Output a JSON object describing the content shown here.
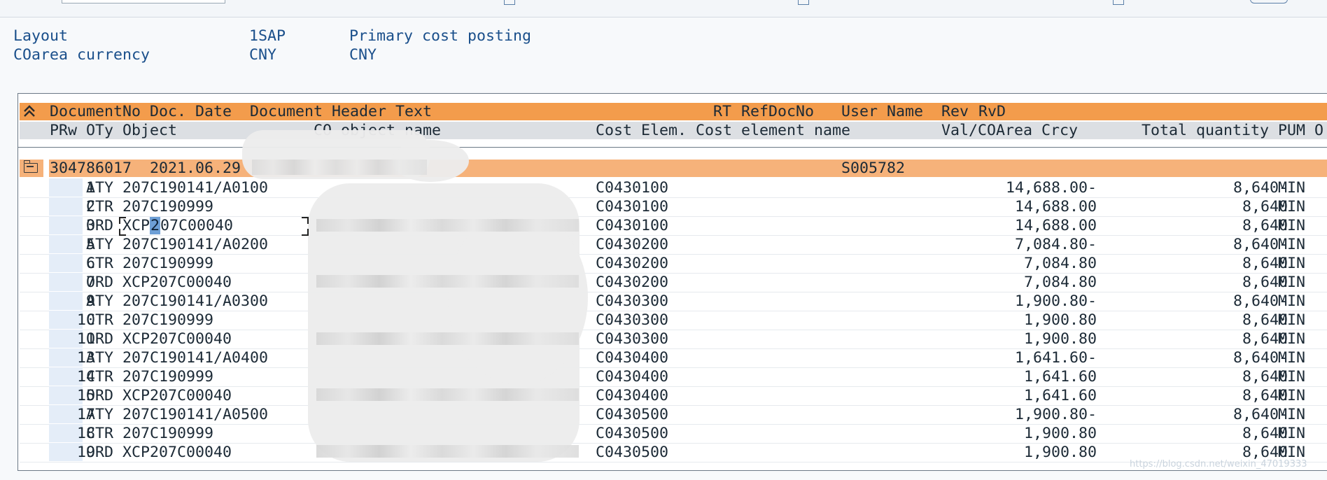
{
  "header": {
    "layout_label": "Layout",
    "layout_value": "1SAP",
    "layout_desc": "Primary cost posting",
    "currency_label": "COarea currency",
    "currency_value": "CNY",
    "currency_desc": "CNY"
  },
  "columns_line1": {
    "document_no": "DocumentNo",
    "doc_date": "Doc. Date",
    "doc_header_text": "Document Header Text",
    "rt": "RT",
    "ref_doc_no": "RefDocNo",
    "user_name": "User Name",
    "rev": "Rev",
    "rvd": "RvD"
  },
  "columns_line2": {
    "prw": "PRw",
    "oty": "OTy",
    "object": "Object",
    "co_object_name": "CO object name",
    "cost_elem": "Cost Elem.",
    "cost_elem_name": "Cost element name",
    "val_coarea": "Val/COArea Crcy",
    "total_qty": "Total quantity",
    "pum": "PUM",
    "o": "O"
  },
  "group": {
    "document_no": "304786017",
    "doc_date": "2021.06.29",
    "user_name": "S005782"
  },
  "rows": [
    {
      "prw": "1",
      "oty": "ATY",
      "object": "207C190141/A0100",
      "cost_elem": "C0430100",
      "value": "14,688.00-",
      "qty": "8,640-",
      "pum": "MIN"
    },
    {
      "prw": "2",
      "oty": "CTR",
      "object": "207C190999",
      "cost_elem": "C0430100",
      "value": "14,688.00",
      "qty": "8,640",
      "pum": "MIN"
    },
    {
      "prw": "3",
      "oty": "ORD",
      "object": "XCP207C00040",
      "cost_elem": "C0430100",
      "value": "14,688.00",
      "qty": "8,640",
      "pum": "MIN"
    },
    {
      "prw": "5",
      "oty": "ATY",
      "object": "207C190141/A0200",
      "cost_elem": "C0430200",
      "value": "7,084.80-",
      "qty": "8,640-",
      "pum": "MIN"
    },
    {
      "prw": "6",
      "oty": "CTR",
      "object": "207C190999",
      "cost_elem": "C0430200",
      "value": "7,084.80",
      "qty": "8,640",
      "pum": "MIN"
    },
    {
      "prw": "7",
      "oty": "ORD",
      "object": "XCP207C00040",
      "cost_elem": "C0430200",
      "value": "7,084.80",
      "qty": "8,640",
      "pum": "MIN"
    },
    {
      "prw": "9",
      "oty": "ATY",
      "object": "207C190141/A0300",
      "cost_elem": "C0430300",
      "value": "1,900.80-",
      "qty": "8,640-",
      "pum": "MIN"
    },
    {
      "prw": "10",
      "oty": "CTR",
      "object": "207C190999",
      "cost_elem": "C0430300",
      "value": "1,900.80",
      "qty": "8,640",
      "pum": "MIN"
    },
    {
      "prw": "11",
      "oty": "ORD",
      "object": "XCP207C00040",
      "cost_elem": "C0430300",
      "value": "1,900.80",
      "qty": "8,640",
      "pum": "MIN"
    },
    {
      "prw": "13",
      "oty": "ATY",
      "object": "207C190141/A0400",
      "cost_elem": "C0430400",
      "value": "1,641.60-",
      "qty": "8,640-",
      "pum": "MIN"
    },
    {
      "prw": "14",
      "oty": "CTR",
      "object": "207C190999",
      "cost_elem": "C0430400",
      "value": "1,641.60",
      "qty": "8,640",
      "pum": "MIN"
    },
    {
      "prw": "15",
      "oty": "ORD",
      "object": "XCP207C00040",
      "cost_elem": "C0430400",
      "value": "1,641.60",
      "qty": "8,640",
      "pum": "MIN"
    },
    {
      "prw": "17",
      "oty": "ATY",
      "object": "207C190141/A0500",
      "cost_elem": "C0430500",
      "value": "1,900.80-",
      "qty": "8,640-",
      "pum": "MIN"
    },
    {
      "prw": "18",
      "oty": "CTR",
      "object": "207C190999",
      "cost_elem": "C0430500",
      "value": "1,900.80",
      "qty": "8,640",
      "pum": "MIN"
    },
    {
      "prw": "19",
      "oty": "ORD",
      "object": "XCP207C00040",
      "cost_elem": "C0430500",
      "value": "1,900.80",
      "qty": "8,640",
      "pum": "MIN"
    }
  ],
  "row3_object_parts": {
    "pre": "XCP",
    "sel": "2",
    "post": "07C00040"
  },
  "colors": {
    "header_orange": "#f39c4c",
    "group_orange": "#f6b27a",
    "header_gray": "#dcdfe3",
    "label_blue": "#1a4f8b",
    "row_number_bg": "#e4edf8"
  }
}
